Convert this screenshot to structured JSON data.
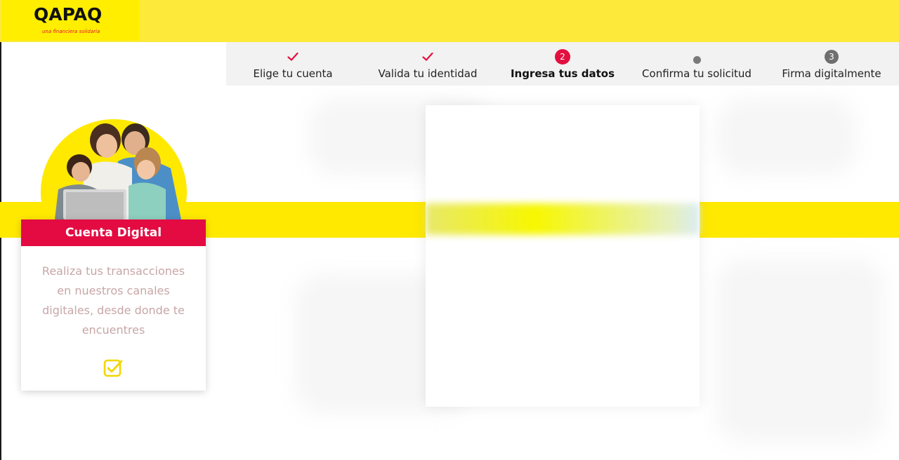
{
  "brand": {
    "name": "QAPAQ",
    "tagline": "una financiera solidaria"
  },
  "steps": [
    {
      "label": "Elige tu cuenta",
      "status": "done"
    },
    {
      "label": "Valida tu identidad",
      "status": "done"
    },
    {
      "label": "Ingresa tus datos",
      "status": "active",
      "badge": "2"
    },
    {
      "label": "Confirma tu solicitud",
      "status": "pending"
    },
    {
      "label": "Firma digitalmente",
      "status": "pending",
      "badge": "3"
    }
  ],
  "card": {
    "title": "Cuenta Digital",
    "description": "Realiza tus transacciones en nuestros canales digitales, desde donde te encuentres",
    "icon": "checkbox-checked-icon"
  },
  "colors": {
    "brand_yellow": "#ffe900",
    "brand_red": "#e30b42",
    "stepper_bg": "#f2f2f2"
  }
}
